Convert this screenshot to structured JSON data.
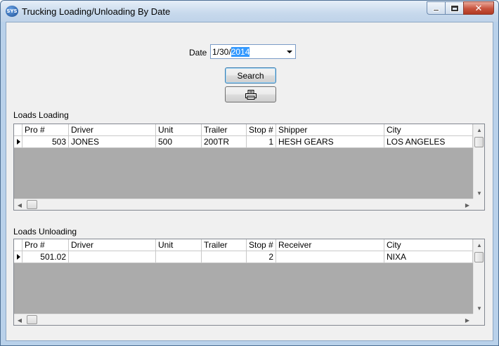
{
  "window": {
    "title": "Trucking Loading/Unloading By Date",
    "icon": "truck-app-icon"
  },
  "filter": {
    "date_label": "Date",
    "date_value_prefix": "1/30/",
    "date_value_selected": "2014"
  },
  "buttons": {
    "search_label": "Search",
    "print_icon": "printer-icon"
  },
  "loading": {
    "label": "Loads Loading",
    "columns": [
      "Pro #",
      "Driver",
      "Unit",
      "Trailer",
      "Stop #",
      "Shipper",
      "City"
    ],
    "rows": [
      {
        "pro": "503",
        "driver": "JONES",
        "unit": "500",
        "trailer": "200TR",
        "stop": "1",
        "party": "HESH GEARS",
        "city": "LOS ANGELES"
      }
    ]
  },
  "unloading": {
    "label": "Loads Unloading",
    "columns": [
      "Pro #",
      "Driver",
      "Unit",
      "Trailer",
      "Stop #",
      "Receiver",
      "City"
    ],
    "rows": [
      {
        "pro": "501.02",
        "driver": "",
        "unit": "",
        "trailer": "",
        "stop": "2",
        "party": "",
        "city": "NIXA"
      }
    ]
  },
  "colors": {
    "title_bar": "#c7d9ec",
    "close_button": "#c7533d",
    "selection": "#3399ff",
    "client_bg": "#f0f0f0",
    "grid_bg": "#ababab"
  }
}
